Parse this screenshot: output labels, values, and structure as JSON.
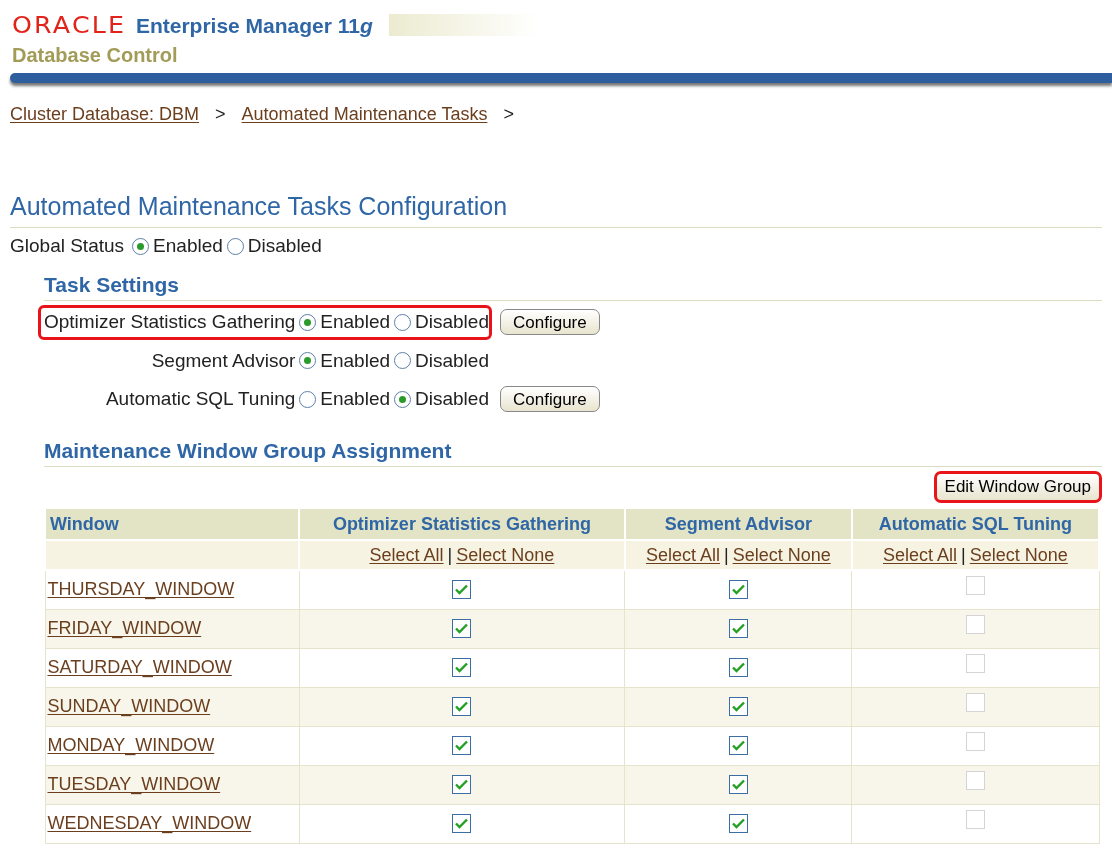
{
  "header": {
    "brand": "ORACLE",
    "product": "Enterprise Manager 11",
    "product_suffix": "g",
    "subtitle": "Database Control"
  },
  "breadcrumb": [
    {
      "label": "Cluster Database: DBM",
      "separator": ">"
    },
    {
      "label": "Automated Maintenance Tasks",
      "separator": ">"
    }
  ],
  "page_title": "Automated Maintenance Tasks Configuration",
  "global_status": {
    "label": "Global Status",
    "options": [
      {
        "label": "Enabled",
        "selected": true
      },
      {
        "label": "Disabled",
        "selected": false
      }
    ]
  },
  "task_settings": {
    "title": "Task Settings",
    "tasks": [
      {
        "label": "Optimizer Statistics Gathering",
        "highlighted": true,
        "options": [
          {
            "label": "Enabled",
            "selected": true
          },
          {
            "label": "Disabled",
            "selected": false
          }
        ],
        "button": "Configure"
      },
      {
        "label": "Segment Advisor",
        "highlighted": false,
        "options": [
          {
            "label": "Enabled",
            "selected": true
          },
          {
            "label": "Disabled",
            "selected": false
          }
        ]
      },
      {
        "label": "Automatic SQL Tuning",
        "highlighted": false,
        "options": [
          {
            "label": "Enabled",
            "selected": false
          },
          {
            "label": "Disabled",
            "selected": true
          }
        ],
        "button": "Configure"
      }
    ]
  },
  "window_group": {
    "title": "Maintenance Window Group Assignment",
    "edit_button": {
      "label": "Edit Window Group",
      "highlighted": true
    },
    "columns": [
      {
        "label": "Window"
      },
      {
        "label": "Optimizer Statistics Gathering",
        "select_all": "Select All",
        "divider": "|",
        "select_none": "Select None"
      },
      {
        "label": "Segment Advisor",
        "select_all": "Select All",
        "divider": "|",
        "select_none": "Select None"
      },
      {
        "label": "Automatic SQL Tuning",
        "select_all": "Select All",
        "divider": "|",
        "select_none": "Select None"
      }
    ],
    "rows": [
      {
        "window": "THURSDAY_WINDOW",
        "cells": [
          {
            "checked": true,
            "disabled": false
          },
          {
            "checked": true,
            "disabled": false
          },
          {
            "checked": false,
            "disabled": true
          }
        ]
      },
      {
        "window": "FRIDAY_WINDOW",
        "cells": [
          {
            "checked": true,
            "disabled": false
          },
          {
            "checked": true,
            "disabled": false
          },
          {
            "checked": false,
            "disabled": true
          }
        ]
      },
      {
        "window": "SATURDAY_WINDOW",
        "cells": [
          {
            "checked": true,
            "disabled": false
          },
          {
            "checked": true,
            "disabled": false
          },
          {
            "checked": false,
            "disabled": true
          }
        ]
      },
      {
        "window": "SUNDAY_WINDOW",
        "cells": [
          {
            "checked": true,
            "disabled": false
          },
          {
            "checked": true,
            "disabled": false
          },
          {
            "checked": false,
            "disabled": true
          }
        ]
      },
      {
        "window": "MONDAY_WINDOW",
        "cells": [
          {
            "checked": true,
            "disabled": false
          },
          {
            "checked": true,
            "disabled": false
          },
          {
            "checked": false,
            "disabled": true
          }
        ]
      },
      {
        "window": "TUESDAY_WINDOW",
        "cells": [
          {
            "checked": true,
            "disabled": false
          },
          {
            "checked": true,
            "disabled": false
          },
          {
            "checked": false,
            "disabled": true
          }
        ]
      },
      {
        "window": "WEDNESDAY_WINDOW",
        "cells": [
          {
            "checked": true,
            "disabled": false
          },
          {
            "checked": true,
            "disabled": false
          },
          {
            "checked": false,
            "disabled": true
          }
        ]
      }
    ]
  }
}
